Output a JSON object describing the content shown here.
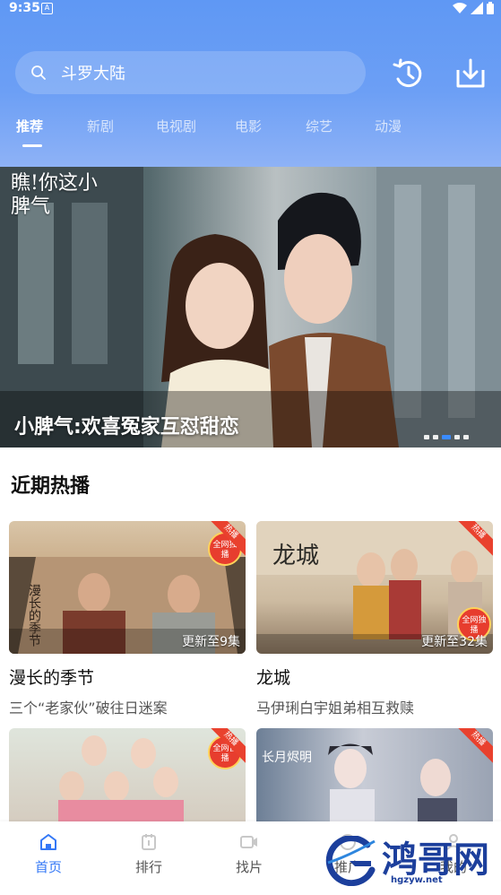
{
  "status_bar": {
    "time": "9:35",
    "app_glyph": "A"
  },
  "search": {
    "text": "斗罗大陆"
  },
  "tabs": [
    {
      "label": "推荐",
      "active": true
    },
    {
      "label": "新剧"
    },
    {
      "label": "电视剧"
    },
    {
      "label": "电影"
    },
    {
      "label": "综艺"
    },
    {
      "label": "动漫"
    }
  ],
  "banner": {
    "logo_text": "瞧!你这小脾气",
    "caption": "小脾气:欢喜冤家互怼甜恋",
    "page_count": 5,
    "active_index": 2
  },
  "section": {
    "title": "近期热播"
  },
  "cards": [
    {
      "title": "漫长的季节",
      "desc": "三个“老家伙”破往日迷案",
      "update": "更新至9集",
      "corner": "热播",
      "badge": "全网独播",
      "poster_text": "漫长的季节"
    },
    {
      "title": "龙城",
      "desc": "马伊琍白宇姐弟相互救赎",
      "update": "更新至32集",
      "corner": "热播",
      "badge": "全网独播",
      "poster_text": "龙城"
    },
    {
      "title": "",
      "desc": "",
      "update": "",
      "corner": "热播",
      "badge": "全网首播",
      "poster_text": ""
    },
    {
      "title": "",
      "desc": "",
      "update": "",
      "corner": "热播",
      "badge": "",
      "poster_text": "长月烬明"
    }
  ],
  "bottom_nav": [
    {
      "label": "首页",
      "icon": "home-icon",
      "active": true
    },
    {
      "label": "排行",
      "icon": "ranking-icon"
    },
    {
      "label": "找片",
      "icon": "video-camera-icon"
    },
    {
      "label": "推广",
      "icon": "promote-icon"
    },
    {
      "label": "我的",
      "icon": "profile-icon"
    }
  ],
  "watermark": {
    "text": "鸿哥网",
    "url": "hgzyw.net"
  },
  "colors": {
    "accent": "#3478f6",
    "header_top": "#5f98f4",
    "badge_red": "#e9412e"
  }
}
